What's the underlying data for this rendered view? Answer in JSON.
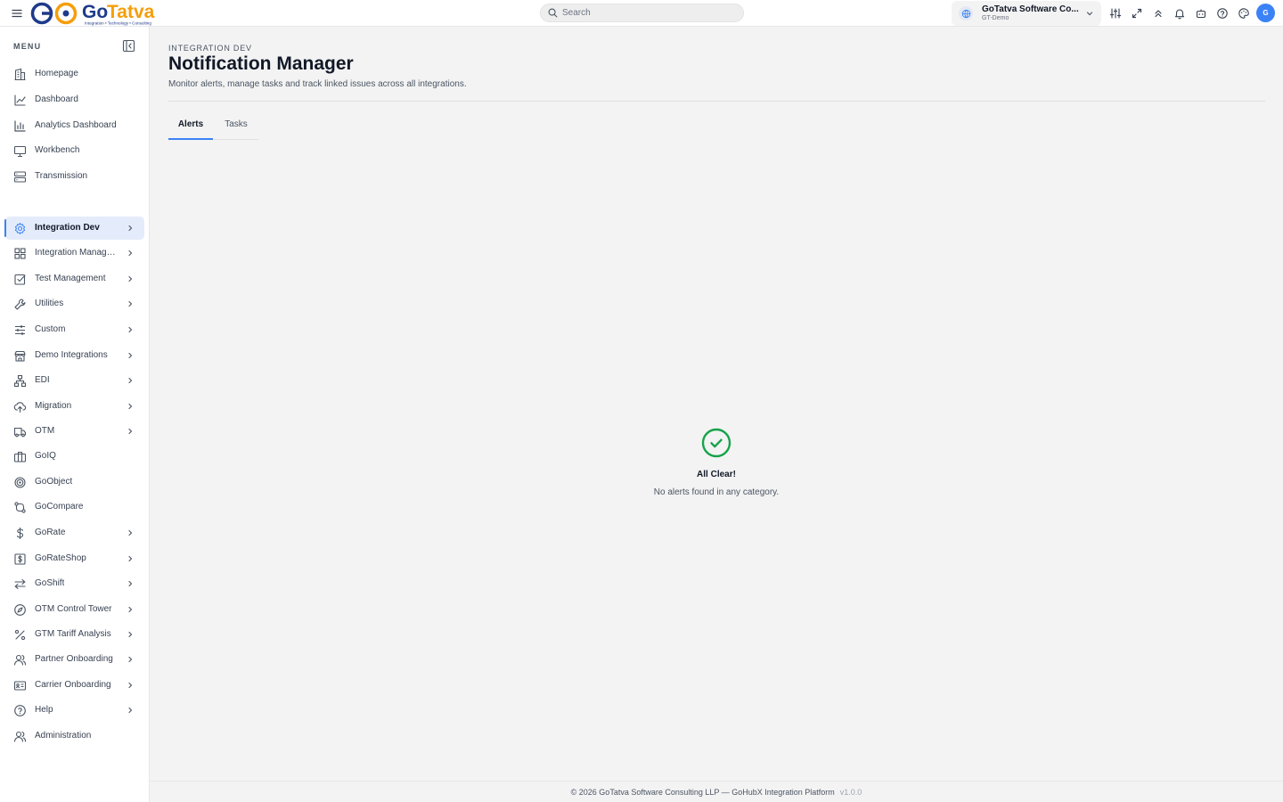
{
  "header": {
    "logo_text": "GoTatva",
    "logo_tagline": "Integration • Technology • Consulting",
    "search_placeholder": "Search",
    "tenant_name": "GoTatva Software Co...",
    "tenant_env": "GT-Demo",
    "avatar_initial": "G",
    "icons": [
      "sliders-icon",
      "expand-icon",
      "chevrons-up-icon",
      "bell-icon",
      "bot-icon",
      "help-circle-icon",
      "palette-icon"
    ]
  },
  "sidebar": {
    "menu_label": "MENU",
    "items": [
      {
        "label": "Homepage",
        "icon": "building-icon",
        "has_children": false
      },
      {
        "label": "Dashboard",
        "icon": "line-chart-icon",
        "has_children": false
      },
      {
        "label": "Analytics Dashboard",
        "icon": "bar-chart-icon",
        "has_children": false
      },
      {
        "label": "Workbench",
        "icon": "monitor-icon",
        "has_children": false
      },
      {
        "label": "Transmission",
        "icon": "server-icon",
        "has_children": false
      },
      {
        "label": "Integration Dev",
        "icon": "gear-icon",
        "has_children": true,
        "active": true
      },
      {
        "label": "Integration Management",
        "icon": "grid-icon",
        "has_children": true
      },
      {
        "label": "Test Management",
        "icon": "checkbox-icon",
        "has_children": true
      },
      {
        "label": "Utilities",
        "icon": "wrench-icon",
        "has_children": true
      },
      {
        "label": "Custom",
        "icon": "sliders-horizontal-icon",
        "has_children": true
      },
      {
        "label": "Demo Integrations",
        "icon": "store-icon",
        "has_children": true
      },
      {
        "label": "EDI",
        "icon": "network-icon",
        "has_children": true
      },
      {
        "label": "Migration",
        "icon": "cloud-upload-icon",
        "has_children": true
      },
      {
        "label": "OTM",
        "icon": "truck-icon",
        "has_children": true
      },
      {
        "label": "GoIQ",
        "icon": "briefcase-icon",
        "has_children": false
      },
      {
        "label": "GoObject",
        "icon": "target-icon",
        "has_children": false
      },
      {
        "label": "GoCompare",
        "icon": "git-compare-icon",
        "has_children": false
      },
      {
        "label": "GoRate",
        "icon": "dollar-icon",
        "has_children": true
      },
      {
        "label": "GoRateShop",
        "icon": "dollar-square-icon",
        "has_children": true
      },
      {
        "label": "GoShift",
        "icon": "arrows-left-right-icon",
        "has_children": true
      },
      {
        "label": "OTM Control Tower",
        "icon": "compass-icon",
        "has_children": true
      },
      {
        "label": "GTM Tariff Analysis",
        "icon": "percent-icon",
        "has_children": true
      },
      {
        "label": "Partner Onboarding",
        "icon": "users-icon",
        "has_children": true
      },
      {
        "label": "Carrier Onboarding",
        "icon": "id-card-icon",
        "has_children": true
      },
      {
        "label": "Help",
        "icon": "help-circle-icon",
        "has_children": true
      },
      {
        "label": "Administration",
        "icon": "users-icon",
        "has_children": false
      }
    ]
  },
  "main": {
    "breadcrumb": "INTEGRATION DEV",
    "title": "Notification Manager",
    "subtitle": "Monitor alerts, manage tasks and track linked issues across all integrations.",
    "tabs": [
      {
        "label": "Alerts",
        "active": true
      },
      {
        "label": "Tasks",
        "active": false
      }
    ],
    "empty_state": {
      "title": "All Clear!",
      "text": "No alerts found in any category."
    }
  },
  "footer": {
    "text": "© 2026 GoTatva Software Consulting LLP — GoHubX Integration Platform",
    "version": "v1.0.0"
  },
  "colors": {
    "accent": "#3b82f6",
    "success": "#16a34a",
    "active_bg": "#e4ecfb",
    "logo_blue": "#1e40af",
    "logo_orange": "#f59e0b"
  }
}
